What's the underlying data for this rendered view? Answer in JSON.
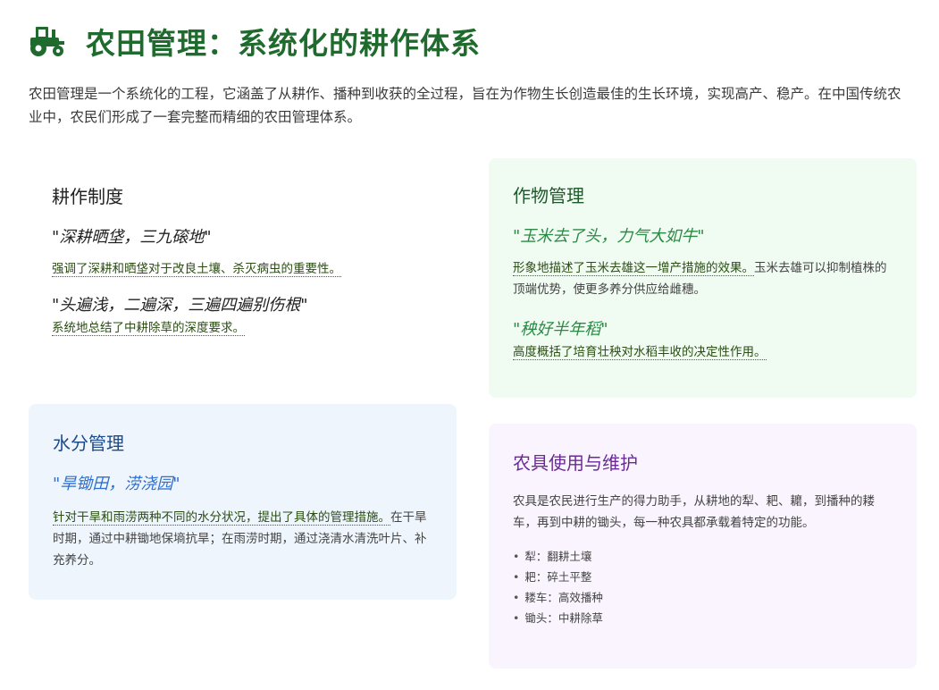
{
  "page": {
    "title": "农田管理：系统化的耕作体系",
    "icon": "tractor-icon",
    "intro": "农田管理是一个系统化的工程，它涵盖了从耕作、播种到收获的全过程，旨在为作物生长创造最佳的生长环境，实现高产、稳产。在中国传统农业中，农民们形成了一套完整而精细的农田管理体系。"
  },
  "cards": {
    "tillage": {
      "title": "耕作制度",
      "quote1": "\"深耕晒垡，三九磙地\"",
      "note1": "强调了深耕和晒垡对于改良土壤、杀灭病虫的重要性。",
      "quote2": "\"头遍浅，二遍深，三遍四遍别伤根\"",
      "note2": "系统地总结了中耕除草的深度要求。"
    },
    "crop": {
      "title": "作物管理",
      "quote1": "\"玉米去了头，力气大如牛\"",
      "note1": "形象地描述了玉米去雄这一增产措施的效果。",
      "desc1": "玉米去雄可以抑制植株的顶端优势，使更多养分供应给雌穗。",
      "quote2": "\"秧好半年稻\"",
      "note2": "高度概括了培育壮秧对水稻丰收的决定性作用。"
    },
    "water": {
      "title": "水分管理",
      "quote1": "\"旱锄田，涝浇园\"",
      "note1": "针对干旱和雨涝两种不同的水分状况，提出了具体的管理措施。",
      "desc1": "在干旱时期，通过中耕锄地保墒抗旱；在雨涝时期，通过浇清水清洗叶片、补充养分。"
    },
    "tools": {
      "title": "农具使用与维护",
      "desc": "农具是农民进行生产的得力助手，从耕地的犁、耙、耱，到播种的耧车，再到中耕的锄头，每一种农具都承载着特定的功能。",
      "items": [
        "犁：翻耕土壤",
        "耙：碎土平整",
        "耧车：高效播种",
        "锄头：中耕除草"
      ]
    }
  },
  "colors": {
    "title_green": "#1f6b2e",
    "crop_bg": "#f0fbf2",
    "water_bg": "#eef5fd",
    "tools_bg": "#f9f4fd",
    "water_quote": "#2f6fd0",
    "crop_quote": "#2a8a45",
    "tools_title": "#6a2a95"
  }
}
